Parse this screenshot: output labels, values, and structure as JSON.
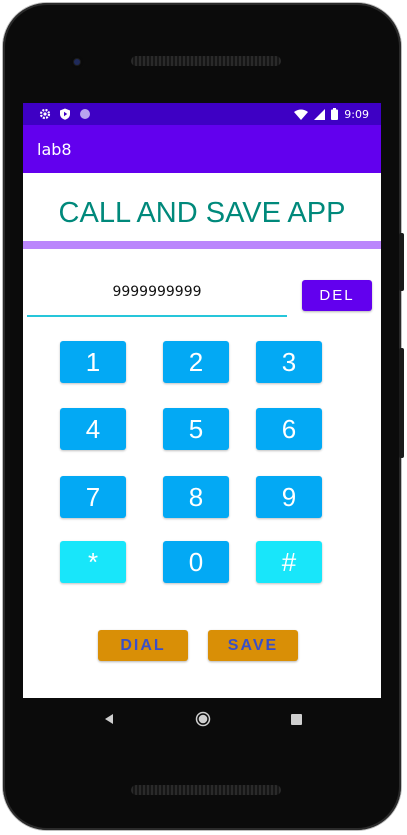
{
  "status_bar": {
    "time": "9:09",
    "left_icons": [
      "gear-icon",
      "shield-play-icon",
      "dot-icon"
    ],
    "right_icons": [
      "wifi-icon",
      "signal-icon",
      "battery-icon"
    ]
  },
  "app_bar": {
    "title": "lab8"
  },
  "header": {
    "title": "CALL AND SAVE APP"
  },
  "phone_input": {
    "value": "9999999999"
  },
  "del_button": {
    "label": "DEL"
  },
  "keypad": {
    "rows": [
      [
        {
          "label": "1",
          "color": "#03a9f4"
        },
        {
          "label": "2",
          "color": "#03a9f4"
        },
        {
          "label": "3",
          "color": "#03a9f4"
        }
      ],
      [
        {
          "label": "4",
          "color": "#03a9f4"
        },
        {
          "label": "5",
          "color": "#03a9f4"
        },
        {
          "label": "6",
          "color": "#03a9f4"
        }
      ],
      [
        {
          "label": "7",
          "color": "#03a9f4"
        },
        {
          "label": "8",
          "color": "#03a9f4"
        },
        {
          "label": "9",
          "color": "#03a9f4"
        }
      ],
      [
        {
          "label": "*",
          "color": "#18e6fa"
        },
        {
          "label": "0",
          "color": "#03a9f4"
        },
        {
          "label": "#",
          "color": "#18e6fa"
        }
      ]
    ]
  },
  "actions": {
    "dial_label": "DIAL",
    "save_label": "SAVE"
  },
  "nav": {
    "icons": [
      "back-icon",
      "home-icon",
      "recents-icon"
    ]
  },
  "colors": {
    "status_bar": "#3e00c4",
    "app_bar": "#6200ee",
    "title_text": "#00897b",
    "divider": "#bb86fc",
    "action_button": "#d98f06",
    "action_text": "#3a4fc8"
  }
}
